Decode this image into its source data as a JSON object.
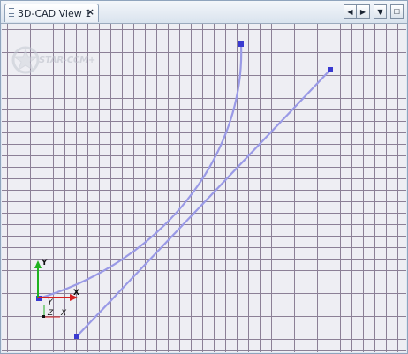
{
  "tab": {
    "title": "3D-CAD View 1",
    "close_glyph": "×",
    "icon": "view-icon"
  },
  "window_controls": {
    "left": "◀",
    "right": "▶",
    "dropdown": "▼",
    "maximize": "☐"
  },
  "viewport": {
    "watermark": "STAR-CCM+",
    "grid": true,
    "grid_color": "#8c8096",
    "background": "#eeeef3",
    "curve_color": "#9a9ae6",
    "vertex_color": "#3a3ad0"
  },
  "triad": {
    "y_label": "Y",
    "x_label": "X",
    "z_label": "Z",
    "x2_label": "X",
    "y_color": "#1fb21f",
    "x_color": "#d62020"
  }
}
